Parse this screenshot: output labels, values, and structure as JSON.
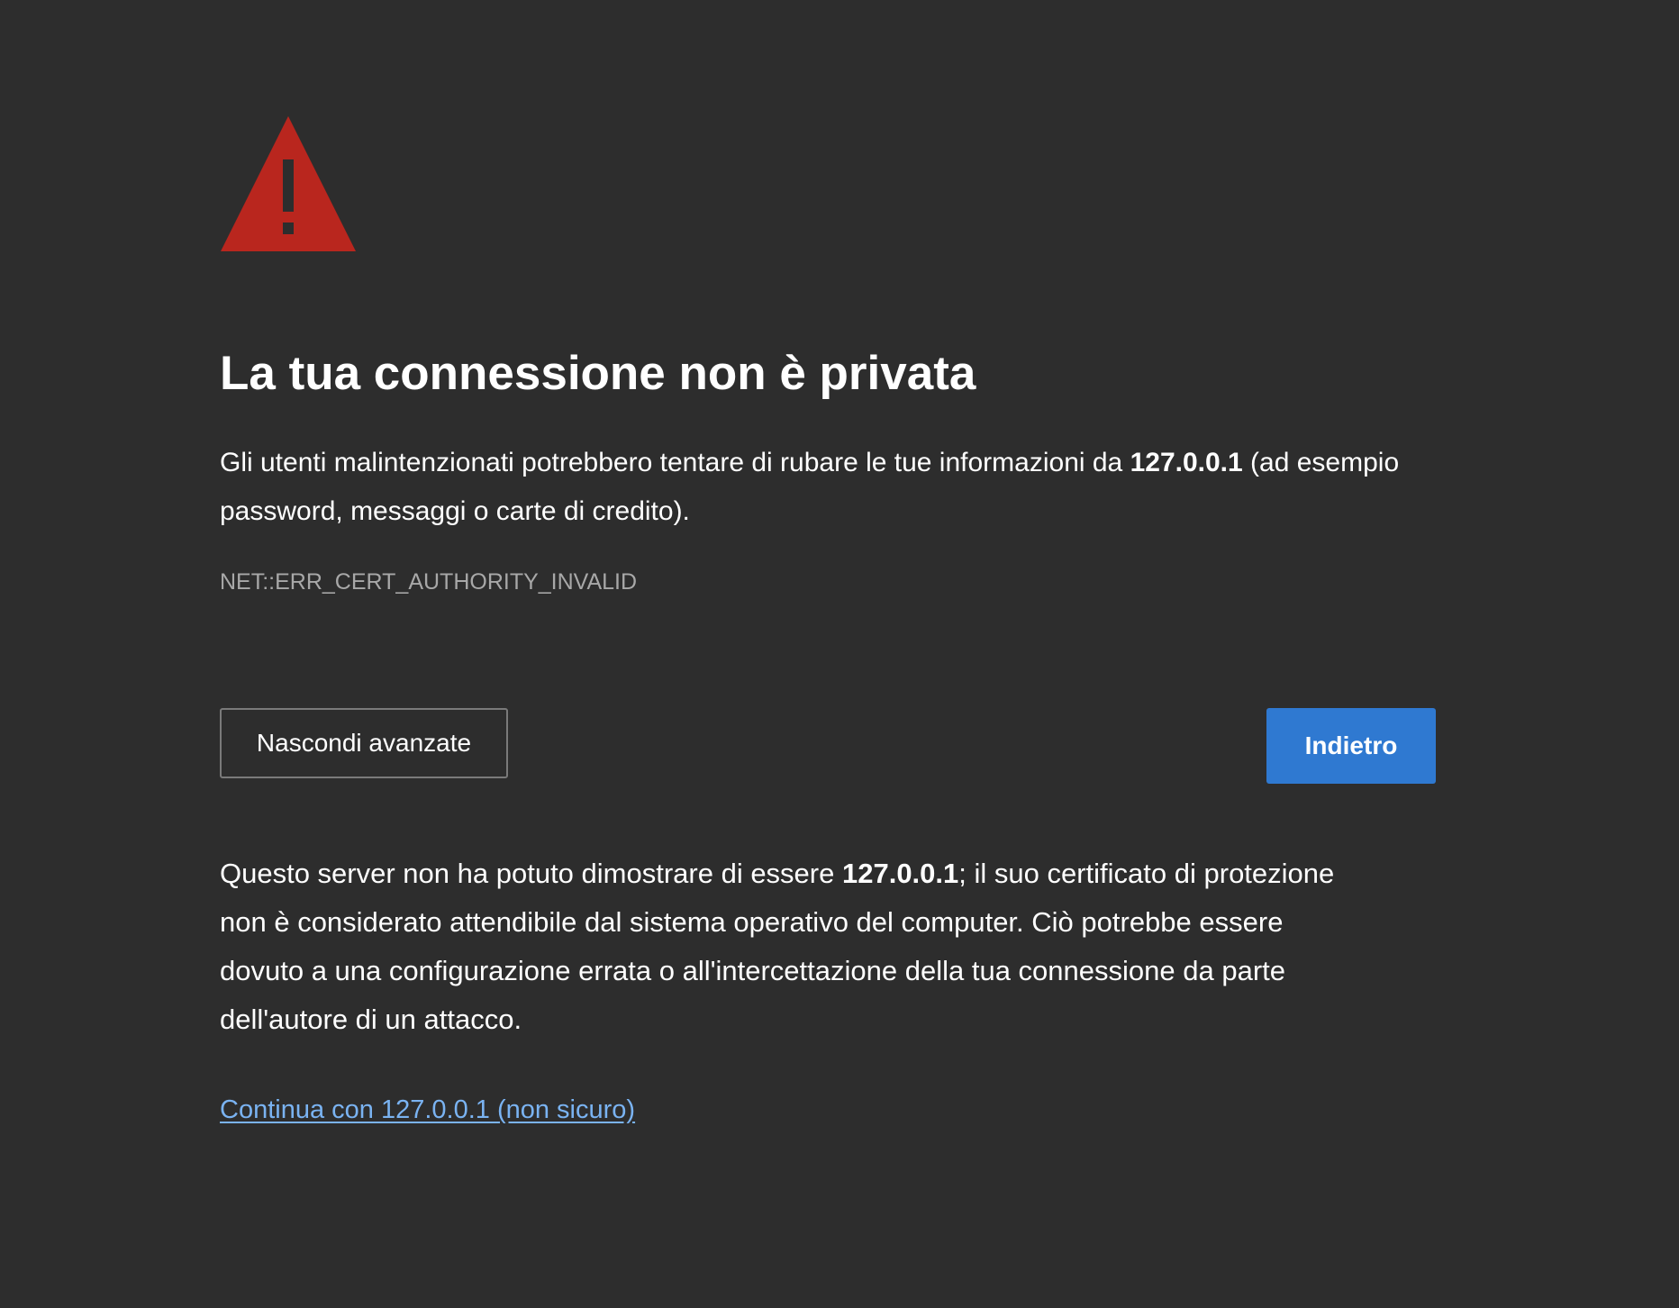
{
  "icons": {
    "warning": "warning-triangle-icon",
    "warning_color": "#b9261e"
  },
  "heading": {
    "title": "La tua connessione non è privata"
  },
  "summary": {
    "before_host": "Gli utenti malintenzionati potrebbero tentare di rubare le tue informazioni da ",
    "host": "127.0.0.1",
    "after_host": " (ad esempio password, messaggi o carte di credito)."
  },
  "error_code": "NET::ERR_CERT_AUTHORITY_INVALID",
  "buttons": {
    "advanced_label": "Nascondi avanzate",
    "back_label": "Indietro"
  },
  "details": {
    "before_host": "Questo server non ha potuto dimostrare di essere ",
    "host": "127.0.0.1",
    "after_host": "; il suo certificato di protezione non è considerato attendibile dal sistema operativo del computer. Ciò potrebbe essere dovuto a una configurazione errata o all'intercettazione della tua connessione da parte dell'autore di un attacco."
  },
  "proceed_link": "Continua con 127.0.0.1 (non sicuro)",
  "colors": {
    "background": "#2d2d2d",
    "primary_button": "#2f79d1",
    "link": "#7ab3f2",
    "error_code_text": "#a8a8a8"
  }
}
